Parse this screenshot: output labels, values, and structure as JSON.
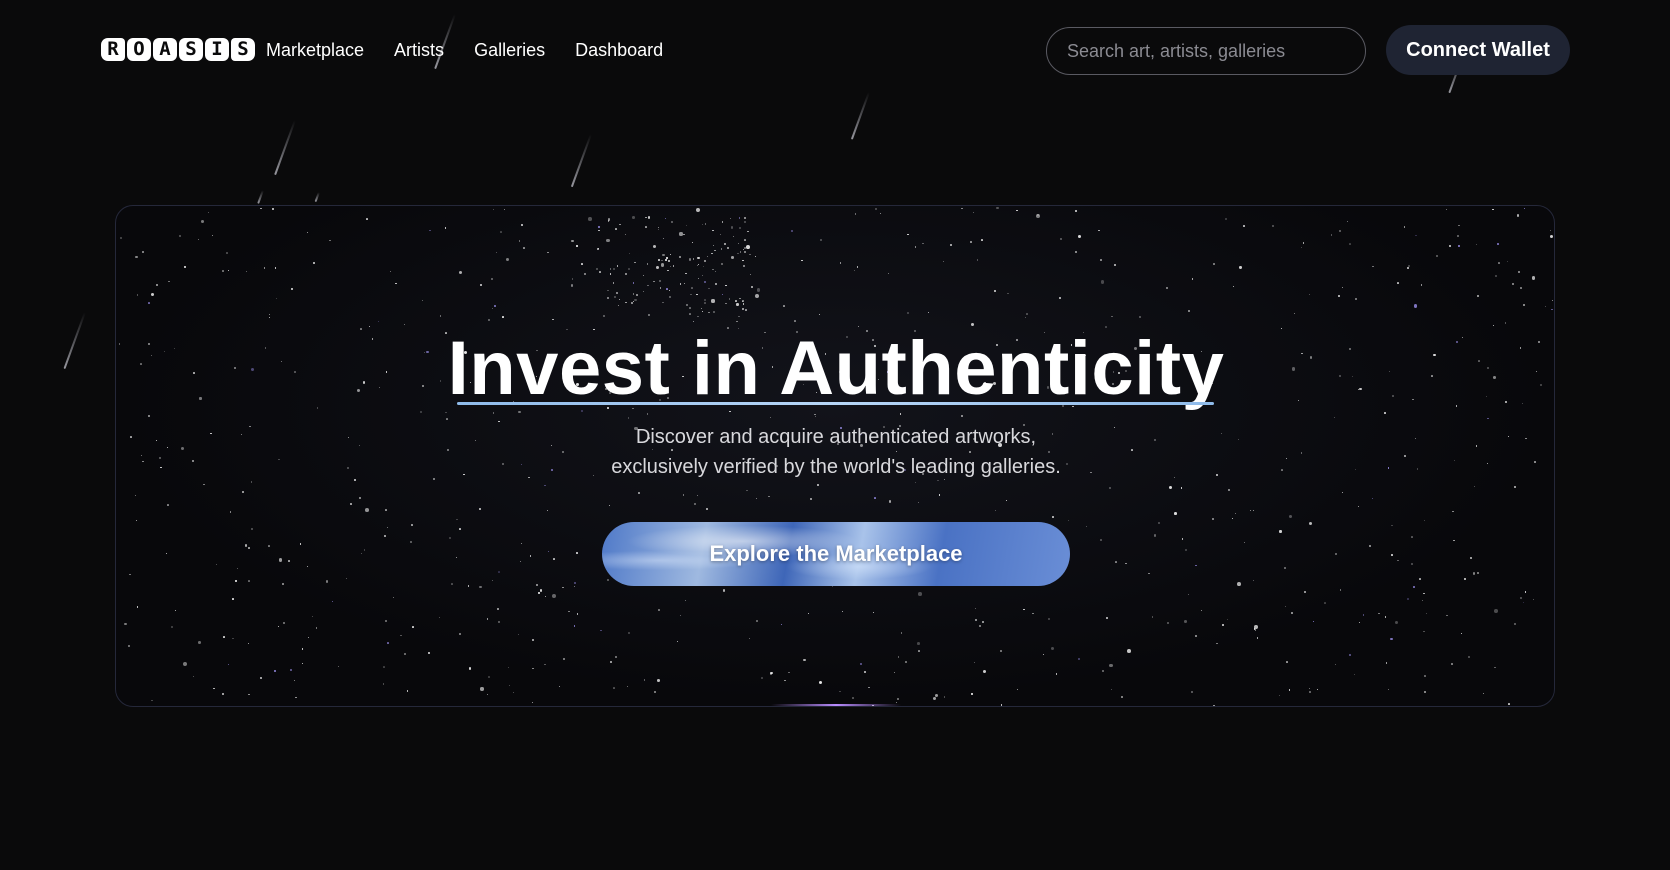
{
  "app": {
    "logo_letters": [
      "R",
      "O",
      "A",
      "S",
      "I",
      "S"
    ]
  },
  "nav": {
    "items": [
      {
        "label": "Marketplace"
      },
      {
        "label": "Artists"
      },
      {
        "label": "Galleries"
      },
      {
        "label": "Dashboard"
      }
    ]
  },
  "search": {
    "placeholder": "Search art, artists, galleries",
    "value": ""
  },
  "header": {
    "connect_wallet_label": "Connect Wallet"
  },
  "hero": {
    "title": "Invest in Authenticity",
    "subtitle_line1": "Discover and acquire authenticated artworks,",
    "subtitle_line2": "exclusively verified by the world's leading galleries.",
    "cta_label": "Explore the Marketplace"
  },
  "colors": {
    "background": "#0a0a0b",
    "connect_button_bg": "#1f2433",
    "underline_accent": "#a8cbf0",
    "cta_blue": "#4f79c8"
  }
}
